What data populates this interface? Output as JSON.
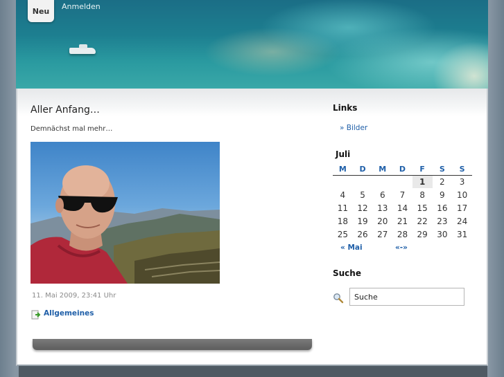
{
  "nav": {
    "new_label": "Neu",
    "login_label": "Anmelden"
  },
  "post": {
    "title": "Aller Anfang…",
    "text": "Demnächst mal mehr…",
    "date": "11. Mai 2009, 23:41 Uhr",
    "category": "Allgemeines",
    "category_icon": "category-arrow-icon"
  },
  "sidebar": {
    "links_heading": "Links",
    "links": [
      {
        "label": "» Bilder"
      }
    ],
    "calendar": {
      "month": "Juli",
      "weekdays": [
        "M",
        "D",
        "M",
        "D",
        "F",
        "S",
        "S"
      ],
      "weeks": [
        [
          "",
          "",
          "",
          "",
          "1",
          "2",
          "3"
        ],
        [
          "4",
          "5",
          "6",
          "7",
          "8",
          "9",
          "10"
        ],
        [
          "11",
          "12",
          "13",
          "14",
          "15",
          "16",
          "17"
        ],
        [
          "18",
          "19",
          "20",
          "21",
          "22",
          "23",
          "24"
        ],
        [
          "25",
          "26",
          "27",
          "28",
          "29",
          "30",
          "31"
        ]
      ],
      "today": "1",
      "prev_label": "« Mai",
      "next_label": "«-»"
    },
    "search_heading": "Suche",
    "search_value": "Suche",
    "search_icon": "magnifier-icon"
  },
  "colors": {
    "link": "#1f5fa8",
    "footer_bar": "#6a6a6a"
  }
}
